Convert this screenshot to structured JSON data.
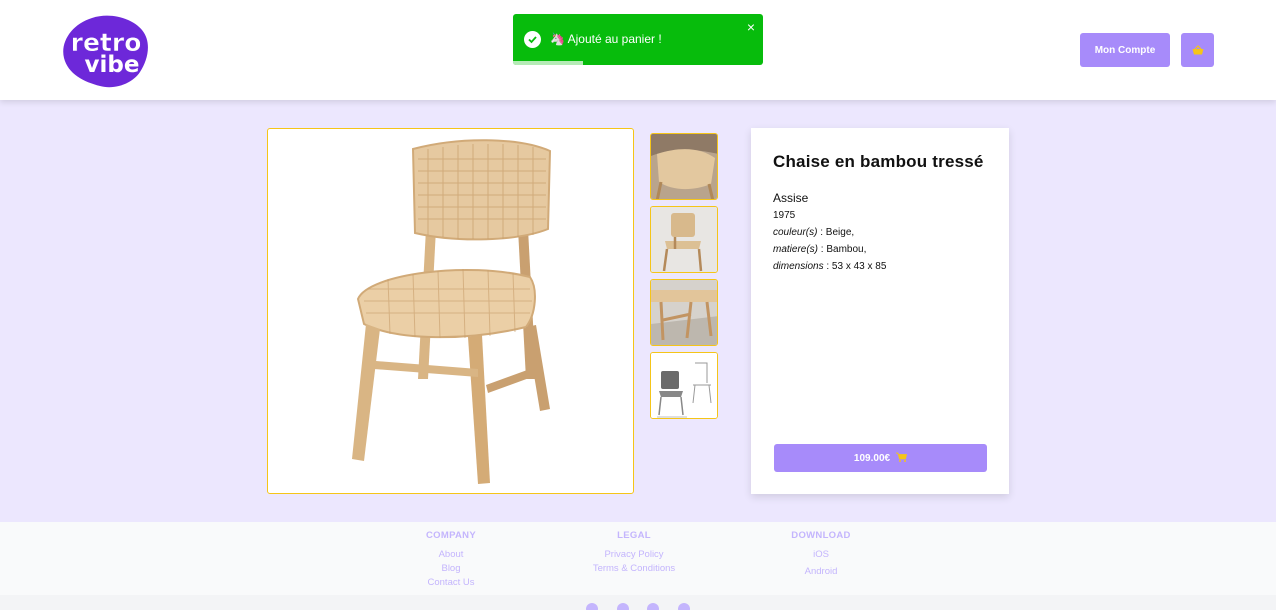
{
  "header": {
    "logo_text_line1": "retro",
    "logo_text_line2": "vibe",
    "account_button": "Mon Compte",
    "cart_icon": "basket-icon"
  },
  "toast": {
    "message": "🦄 Ajouté au panier !",
    "progress": 0.28,
    "color": "#07bc0c"
  },
  "product": {
    "title": "Chaise en bambou tressé",
    "category": "Assise",
    "year": "1975",
    "attributes": [
      {
        "label": "couleur(s)",
        "value": " : Beige,"
      },
      {
        "label": "matiere(s)",
        "value": " : Bambou,"
      },
      {
        "label": "dimensions",
        "value": " : 53 x 43 x 85"
      }
    ],
    "price": "109.00€",
    "thumbnail_count": 4
  },
  "footer": {
    "columns": [
      {
        "title": "COMPANY",
        "links": [
          "About",
          "Blog",
          "Contact Us"
        ]
      },
      {
        "title": "LEGAL",
        "links": [
          "Privacy Policy",
          "Terms & Conditions"
        ]
      },
      {
        "title": "DOWNLOAD",
        "links": [
          "iOS",
          "Android"
        ]
      }
    ],
    "social": [
      "facebook-icon",
      "instagram-icon",
      "twitter-icon",
      "github-icon"
    ]
  },
  "colors": {
    "accent": "#a78bfa",
    "page_bg": "#ece7fe",
    "border": "#f5c518",
    "logo": "#6d28d9"
  }
}
